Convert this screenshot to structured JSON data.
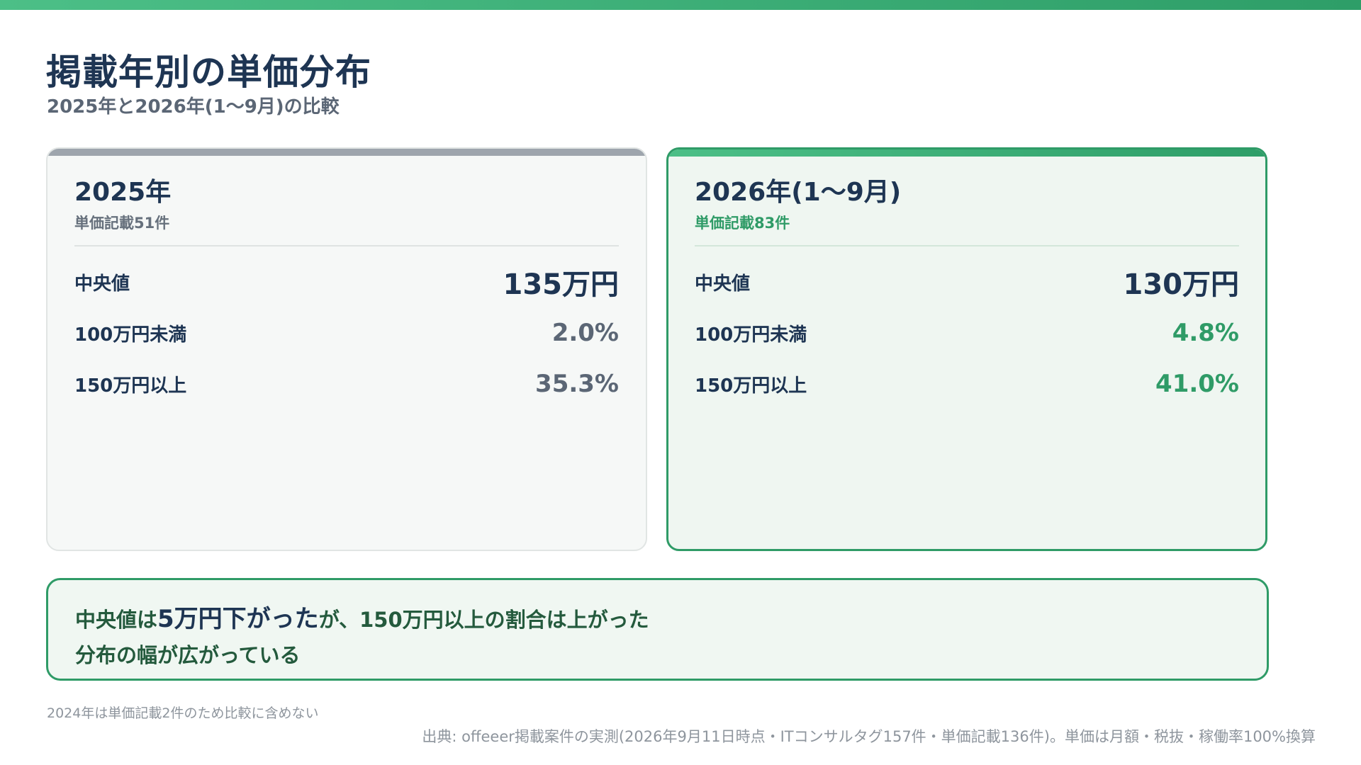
{
  "header": {
    "title": "掲載年別の単価分布",
    "subtitle": "2025年と2026年(1〜9月)の比較",
    "accent_color": "#3aae78"
  },
  "cards": [
    {
      "year": "2025年",
      "count_label": "単価記載51件",
      "accent_color": "#9ea5ad",
      "stats": [
        {
          "label": "中央値",
          "value": "135万円"
        },
        {
          "label": "100万円未満",
          "value": "2.0%"
        },
        {
          "label": "150万円以上",
          "value": "35.3%"
        }
      ]
    },
    {
      "year": "2026年(1〜9月)",
      "count_label": "単価記載83件",
      "accent_color": "#2f9b67",
      "stats": [
        {
          "label": "中央値",
          "value": "130万円"
        },
        {
          "label": "100万円未満",
          "value": "4.8%"
        },
        {
          "label": "150万円以上",
          "value": "41.0%"
        }
      ]
    }
  ],
  "insight": {
    "line1_prefix": "中央値は",
    "line1_emphasis": "5万円下がった",
    "line1_suffix": "が、150万円以上の割合は上がった",
    "line2": "分布の幅が広がっている"
  },
  "footnote": "2024年は単価記載2件のため比較に含めない",
  "source": "出典: offeeer掲載案件の実測(2026年9月11日時点・ITコンサルタグ157件・単価記載136件)。単価は月額・税抜・稼働率100%換算"
}
